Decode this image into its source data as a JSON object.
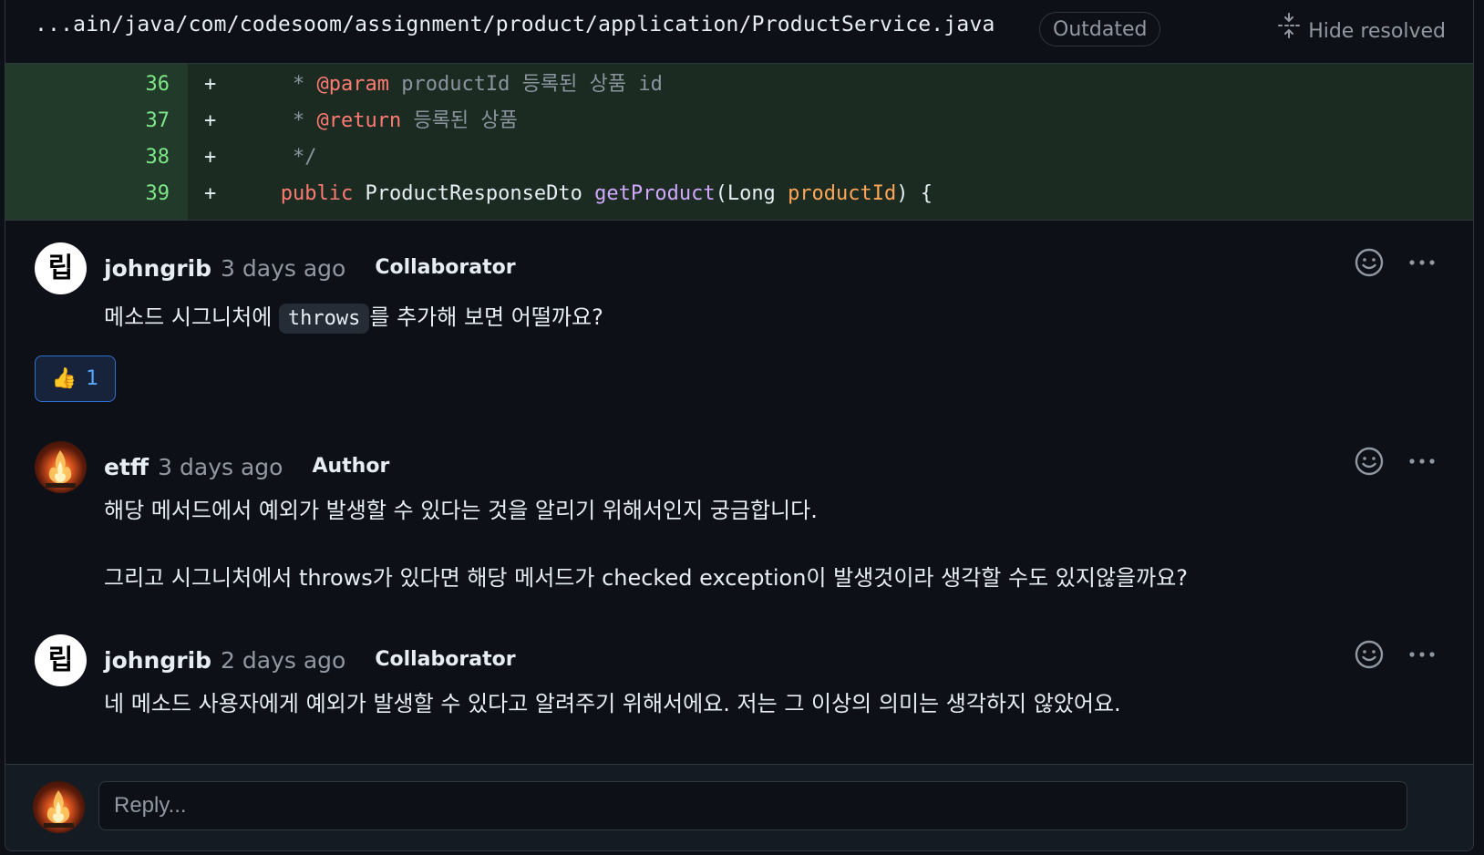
{
  "header": {
    "file_path": "...ain/java/com/codesoom/assignment/product/application/ProductService.java",
    "outdated_label": "Outdated",
    "hide_resolved_label": "Hide resolved"
  },
  "code_lines": [
    {
      "number": "36",
      "marker": "+",
      "parts": [
        [
          "comment",
          "    * "
        ],
        [
          "kw",
          "@param"
        ],
        [
          "comment",
          " productId 등록된 상품 id"
        ]
      ]
    },
    {
      "number": "37",
      "marker": "+",
      "parts": [
        [
          "comment",
          "    * "
        ],
        [
          "kw",
          "@return"
        ],
        [
          "comment",
          " 등록된 상품"
        ]
      ]
    },
    {
      "number": "38",
      "marker": "+",
      "parts": [
        [
          "comment",
          "    */"
        ]
      ]
    },
    {
      "number": "39",
      "marker": "+",
      "parts": [
        [
          "kw",
          "   public"
        ],
        [
          "type",
          " ProductResponseDto "
        ],
        [
          "fn",
          "getProduct"
        ],
        [
          "type",
          "(Long "
        ],
        [
          "var",
          "productId"
        ],
        [
          "type",
          ") {"
        ]
      ]
    }
  ],
  "comments": [
    {
      "author": "johngrib",
      "time": "3 days ago",
      "role": "Collaborator",
      "avatar_text": "립",
      "body_before": "메소드 시그니처에 ",
      "body_code": "throws",
      "body_after": "를 추가해 보면 어떨까요?",
      "reaction": {
        "emoji": "👍",
        "count": "1"
      }
    },
    {
      "author": "etff",
      "time": "3 days ago",
      "role": "Author",
      "body_line1": "해당 메서드에서 예외가 발생할 수 있다는 것을 알리기 위해서인지 궁금합니다.",
      "body_line2": "그리고 시그니처에서 throws가 있다면 해당 메서드가 checked exception이 발생것이라 생각할 수도 있지않을까요?"
    },
    {
      "author": "johngrib",
      "time": "2 days ago",
      "role": "Collaborator",
      "avatar_text": "립",
      "body": "네 메소드 사용자에게 예외가 발생할 수 있다고 알려주기 위해서에요. 저는 그 이상의 의미는 생각하지 않았어요."
    }
  ],
  "reply": {
    "placeholder": "Reply..."
  },
  "icons": {
    "hide_resolved": "fold-icon",
    "emoji": "smiley-icon",
    "more": "kebab-horizontal-icon"
  },
  "colors": {
    "background": "#0d1117",
    "added_line_bg": "#1b2b22",
    "keyword": "#ff7b72",
    "function": "#d2a8ff",
    "variable": "#ffa657",
    "link_blue": "#58a6ff"
  }
}
